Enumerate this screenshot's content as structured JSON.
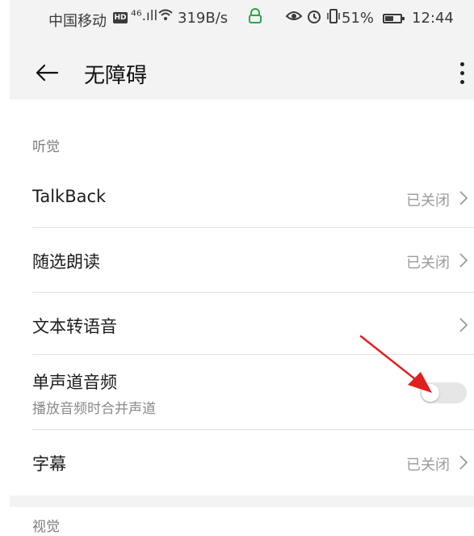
{
  "status_bar": {
    "carrier": "中国移动",
    "hd_badge": "HD",
    "network": "⁴⁶.ıll",
    "speed": "319B/s",
    "battery_percent": "51%",
    "time": "12:44"
  },
  "app_bar": {
    "title": "无障碍"
  },
  "sections": [
    {
      "header": "听觉",
      "items": [
        {
          "label": "TalkBack",
          "value": "已关闭"
        },
        {
          "label": "随选朗读",
          "value": "已关闭"
        },
        {
          "label": "文本转语音",
          "value": ""
        },
        {
          "label": "单声道音频",
          "subtitle": "播放音频时合并声道",
          "toggle_on": false
        },
        {
          "label": "字幕",
          "value": "已关闭"
        }
      ]
    },
    {
      "header": "视觉"
    }
  ],
  "colors": {
    "background": "#f3f3f3",
    "panel": "#ffffff",
    "secondary_text": "#9b9b9b",
    "annotation_arrow": "#e02020",
    "toggle_off": "#e6e6e6"
  },
  "icons": {
    "back": "arrow-left-icon",
    "more": "more-vertical-icon",
    "chevron": "chevron-right-icon",
    "annotation": "red-arrow-annotation"
  }
}
